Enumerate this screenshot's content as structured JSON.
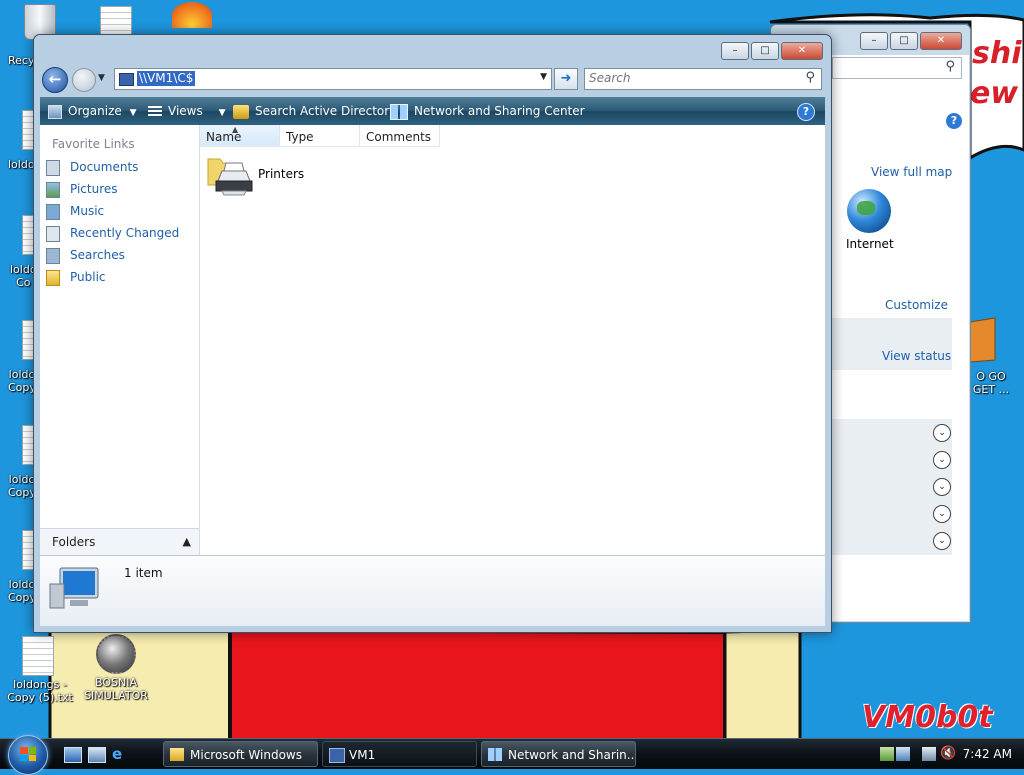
{
  "desktop": {
    "icons": [
      {
        "label": "Recy"
      },
      {
        "label": "loldo"
      },
      {
        "label": "loldo\nCo"
      },
      {
        "label": "loldo\nCopy"
      },
      {
        "label": "loldo\nCopy"
      },
      {
        "label": "loldo\nCopy"
      },
      {
        "label": "loldongs -\nCopy (5).txt"
      },
      {
        "label": "BOSNIA\nSIMULATOR"
      },
      {
        "label": "O GO\nGET ..."
      }
    ],
    "scribble_top": "shi",
    "scribble_bottom": "ew",
    "signature": "VM0b0t"
  },
  "background_window": {
    "links": {
      "view_full_map": "View full map",
      "internet": "Internet",
      "customize": "Customize",
      "view_status": "View status"
    }
  },
  "explorer": {
    "controls": {
      "minimize": "–",
      "maximize": "□",
      "close": "✕"
    },
    "address": "\\\\VM1\\C$",
    "search_placeholder": "Search",
    "toolbar": {
      "organize": "Organize",
      "views": "Views",
      "search_ad": "Search Active Directory",
      "network_center": "Network and Sharing Center",
      "help": "?"
    },
    "favorite_links_title": "Favorite Links",
    "favorite_links": [
      {
        "label": "Documents",
        "icon": "documents-icon"
      },
      {
        "label": "Pictures",
        "icon": "pictures-icon"
      },
      {
        "label": "Music",
        "icon": "music-icon"
      },
      {
        "label": "Recently Changed",
        "icon": "recently-changed-icon"
      },
      {
        "label": "Searches",
        "icon": "searches-icon"
      },
      {
        "label": "Public",
        "icon": "public-folder-icon"
      }
    ],
    "folders_label": "Folders",
    "columns": [
      "Name",
      "Type",
      "Comments"
    ],
    "items": [
      {
        "name": "Printers",
        "icon": "printer-folder-icon"
      }
    ],
    "status": "1 item"
  },
  "taskbar": {
    "buttons": [
      {
        "label": "Microsoft Windows"
      },
      {
        "label": "VM1"
      },
      {
        "label": "Network and Sharin..."
      }
    ],
    "clock": "7:42 AM"
  },
  "colors": {
    "desktop": "#1e96dd",
    "toolbar": "#2d5a76",
    "link": "#1f5fa6",
    "selection": "#3169c6"
  }
}
